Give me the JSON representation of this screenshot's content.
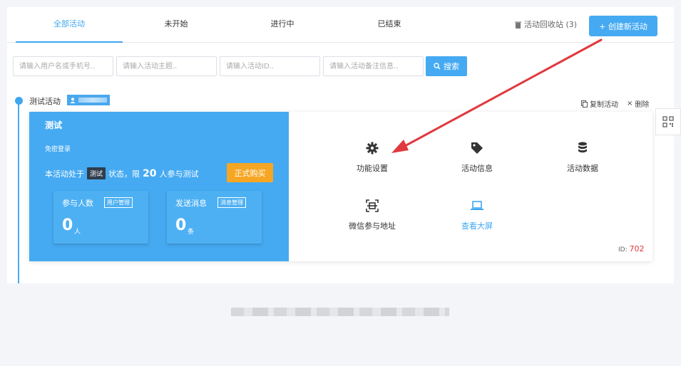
{
  "tabs": [
    {
      "label": "全部活动",
      "active": true
    },
    {
      "label": "未开始"
    },
    {
      "label": "进行中"
    },
    {
      "label": "已结束"
    }
  ],
  "recycle_label": "活动回收站 (3)",
  "create_button": "+ 创建新活动",
  "search": {
    "user_placeholder": "请输入用户名或手机号..",
    "topic_placeholder": "请输入活动主题..",
    "id_placeholder": "请输入活动ID..",
    "note_placeholder": "请输入活动备注信息..",
    "button": "搜索"
  },
  "activity": {
    "name": "测试活动",
    "copy_label": "复制活动",
    "delete_label": "删除",
    "card": {
      "title": "测试",
      "free_login": "免密登录",
      "status_prefix": "本活动处于",
      "status_tag": "测试",
      "status_middle": "状态，限",
      "limit": "20",
      "status_suffix": "人参与测试",
      "buy_button": "正式购买",
      "participants": {
        "label": "参与人数",
        "manage": "用户管理",
        "value": "0",
        "unit": "人"
      },
      "messages": {
        "label": "发送消息",
        "manage": "消息管理",
        "value": "0",
        "unit": "条"
      }
    },
    "features": [
      {
        "label": "功能设置",
        "icon": "gear-icon"
      },
      {
        "label": "活动信息",
        "icon": "tag-icon"
      },
      {
        "label": "活动数据",
        "icon": "database-icon"
      },
      {
        "label": "微信参与地址",
        "icon": "scan-icon"
      },
      {
        "label": "查看大屏",
        "icon": "laptop-icon"
      }
    ],
    "id_prefix": "ID:",
    "id_value": "702"
  },
  "colors": {
    "primary": "#45aaf2",
    "accent": "#3fa7f0",
    "buy": "#f6a623",
    "arrow": "#e0393e"
  }
}
